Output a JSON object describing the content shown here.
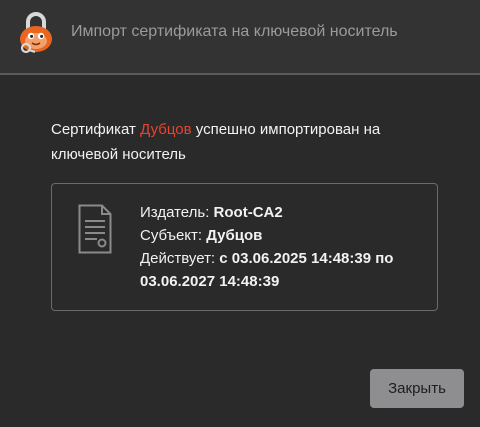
{
  "window": {
    "title": "Импорт сертификата на ключевой носитель"
  },
  "message": {
    "prefix": "Сертификат ",
    "subject_name": "Дубцов",
    "suffix": " успешно импортирован на ключевой носитель"
  },
  "certificate": {
    "issuer_label": "Издатель: ",
    "issuer_value": "Root-CA2",
    "subject_label": "Субъект: ",
    "subject_value": "Дубцов",
    "validity_label": "Действует: ",
    "validity_value": "с 03.06.2025 14:48:39 по 03.06.2027 14:48:39"
  },
  "buttons": {
    "close_label": "Закрыть"
  },
  "colors": {
    "accent": "#e8432c",
    "background": "#2a2a2b",
    "titlebar": "#333334",
    "button": "#8e8e90"
  },
  "icons": {
    "app": "padlock-mascot-icon",
    "certificate": "certificate-document-icon"
  }
}
